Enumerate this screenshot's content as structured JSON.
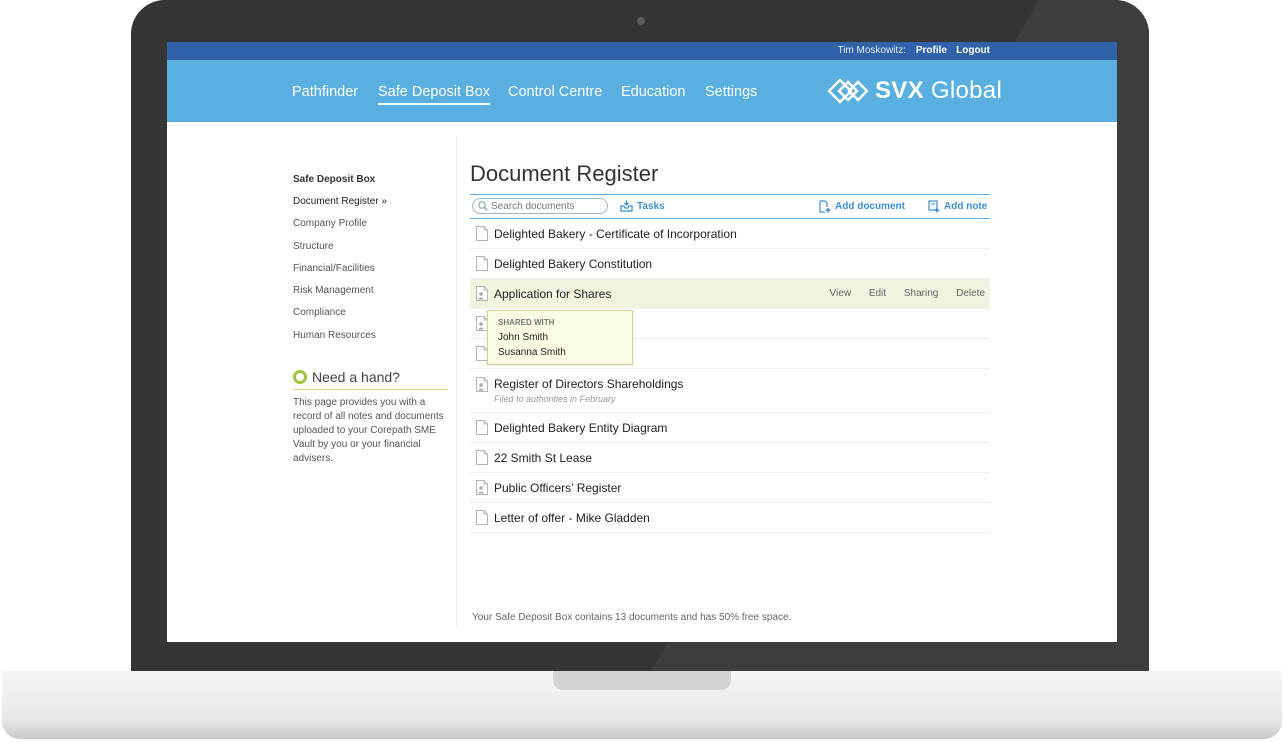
{
  "topbar": {
    "user_label": "Tim Moskowitz:",
    "profile_label": "Profile",
    "logout_label": "Logout"
  },
  "nav": {
    "items": [
      "Pathfinder",
      "Safe Deposit Box",
      "Control Centre",
      "Education",
      "Settings"
    ],
    "active": "Safe Deposit Box"
  },
  "brand": {
    "bold": "SVX",
    "light": "Global"
  },
  "sidebar": {
    "heading": "Safe Deposit Box",
    "links": [
      "Document Register »",
      "Company Profile",
      "Structure",
      "Financial/Facilities",
      "Risk Management",
      "Compliance",
      "Human Resources"
    ]
  },
  "help": {
    "title": "Need a hand?",
    "text": "This page provides you with a record of all notes and documents uploaded to your Corepath SME Vault by you or your financial advisers."
  },
  "main": {
    "title": "Document Register",
    "search_placeholder": "Search documents",
    "tasks_label": "Tasks",
    "add_document_label": "Add document",
    "add_note_label": "Add note"
  },
  "documents": [
    {
      "name": "Delighted Bakery - Certificate of Incorporation",
      "icon": "document-icon"
    },
    {
      "name": "Delighted Bakery Constitution",
      "icon": "document-icon"
    },
    {
      "name": "Application for Shares",
      "icon": "shared-document-icon"
    },
    {
      "name": "",
      "icon": "shared-document-icon"
    },
    {
      "name": "",
      "icon": "document-icon"
    },
    {
      "name": "Register of Directors Shareholdings",
      "note": "Filed to authorities in February",
      "icon": "shared-document-icon"
    },
    {
      "name": "Delighted Bakery Entity Diagram",
      "icon": "document-icon"
    },
    {
      "name": "22 Smith St Lease",
      "icon": "document-icon"
    },
    {
      "name": "Public Officers’ Register",
      "icon": "shared-document-icon"
    },
    {
      "name": "Letter of offer - Mike Gladden",
      "icon": "document-icon"
    }
  ],
  "row_actions": {
    "view": "View",
    "edit": "Edit",
    "sharing": "Sharing",
    "delete": "Delete"
  },
  "popover": {
    "title": "SHARED WITH",
    "names": [
      "John Smith",
      "Susanna Smith"
    ]
  },
  "footer": "Your Safe Deposit Box contains 13 documents and has 50% free space.",
  "colors": {
    "nav_blue": "#58afe0",
    "topbar_blue": "#2f62a8",
    "highlight": "#f1f5e0",
    "accent_link": "#3a8fd2",
    "help_green": "#9cc63b"
  }
}
